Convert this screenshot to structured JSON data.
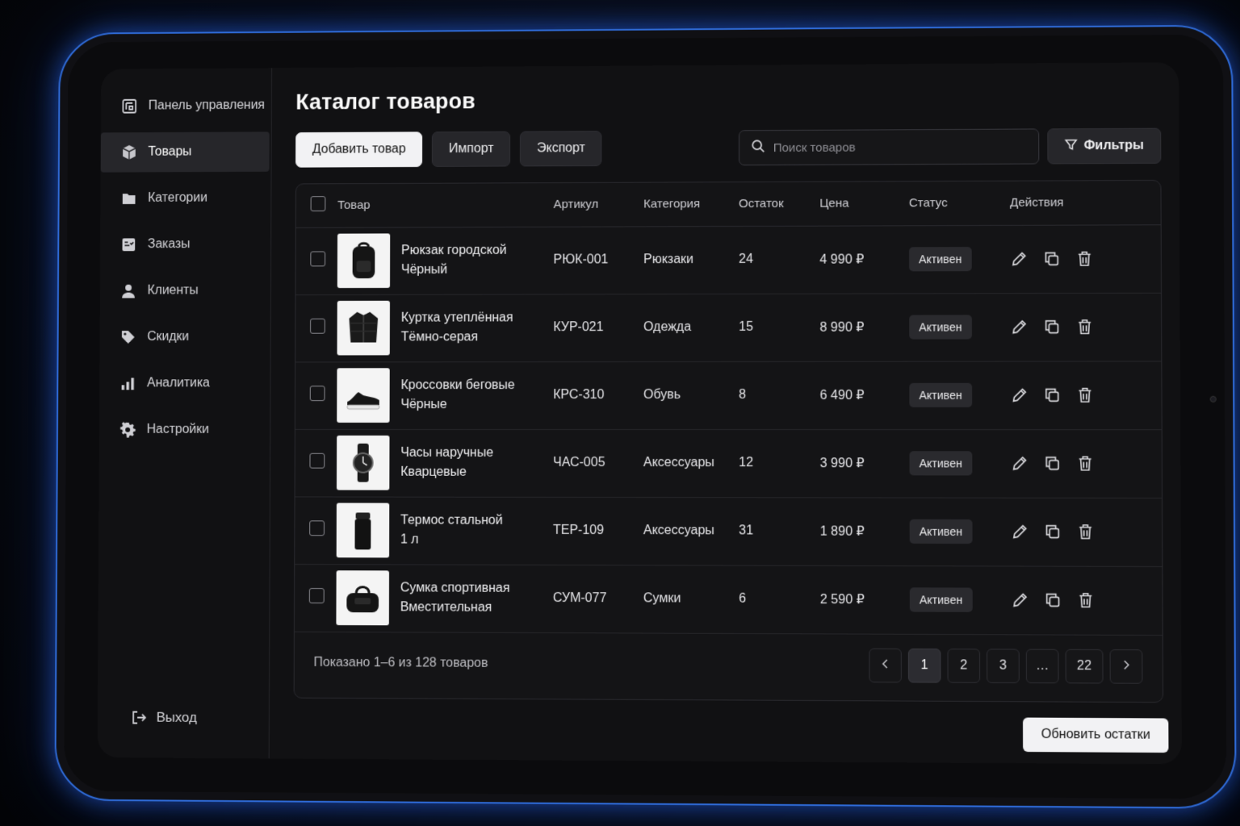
{
  "sidebar": {
    "items": [
      {
        "label": "Панель управления",
        "icon": "dashboard-icon",
        "active": false
      },
      {
        "label": "Товары",
        "icon": "box-icon",
        "active": true
      },
      {
        "label": "Категории",
        "icon": "folder-icon",
        "active": false
      },
      {
        "label": "Заказы",
        "icon": "orders-icon",
        "active": false
      },
      {
        "label": "Клиенты",
        "icon": "user-icon",
        "active": false
      },
      {
        "label": "Скидки",
        "icon": "tag-icon",
        "active": false
      },
      {
        "label": "Аналитика",
        "icon": "chart-icon",
        "active": false
      },
      {
        "label": "Настройки",
        "icon": "gear-icon",
        "active": false
      }
    ],
    "logout_label": "Выход"
  },
  "main": {
    "title": "Каталог товаров",
    "toolbar": {
      "add_label": "Добавить товар",
      "import_label": "Импорт",
      "export_label": "Экспорт",
      "search_placeholder": "Поиск товаров",
      "filter_label": "Фильтры"
    },
    "table": {
      "headers": {
        "product": "Товар",
        "sku": "Артикул",
        "category": "Категория",
        "stock": "Остаток",
        "price": "Цена",
        "status": "Статус",
        "actions": "Действия"
      },
      "rows": [
        {
          "name1": "Рюкзак городской",
          "name2": "Чёрный",
          "sku": "РЮК-001",
          "category": "Рюкзаки",
          "stock": "24",
          "price": "4 990 ₽",
          "status": "Активен",
          "image": "backpack"
        },
        {
          "name1": "Куртка утеплённая",
          "name2": "Тёмно-серая",
          "sku": "КУР-021",
          "category": "Одежда",
          "stock": "15",
          "price": "8 990 ₽",
          "status": "Активен",
          "image": "jacket"
        },
        {
          "name1": "Кроссовки беговые",
          "name2": "Чёрные",
          "sku": "КРС-310",
          "category": "Обувь",
          "stock": "8",
          "price": "6 490 ₽",
          "status": "Активен",
          "image": "sneaker"
        },
        {
          "name1": "Часы наручные",
          "name2": "Кварцевые",
          "sku": "ЧАС-005",
          "category": "Аксессуары",
          "stock": "12",
          "price": "3 990 ₽",
          "status": "Активен",
          "image": "watch"
        },
        {
          "name1": "Термос стальной",
          "name2": "1 л",
          "sku": "ТЕР-109",
          "category": "Аксессуары",
          "stock": "31",
          "price": "1 890 ₽",
          "status": "Активен",
          "image": "thermos"
        },
        {
          "name1": "Сумка спортивная",
          "name2": "Вместительная",
          "sku": "СУМ-077",
          "category": "Сумки",
          "stock": "6",
          "price": "2 590 ₽",
          "status": "Активен",
          "image": "bag"
        }
      ]
    },
    "footer": {
      "shown_text": "Показано 1–6 из 128 товаров",
      "pages": [
        "1",
        "2",
        "3",
        "…",
        "22"
      ],
      "current_page": "1"
    },
    "update_stock_label": "Обновить остатки"
  }
}
